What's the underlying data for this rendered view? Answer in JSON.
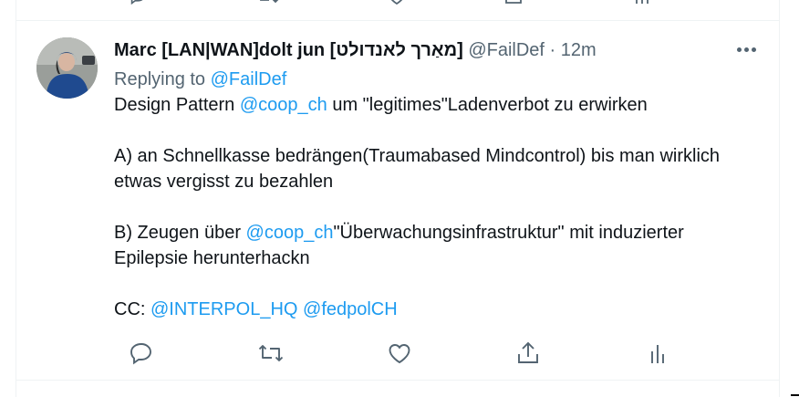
{
  "tweet": {
    "author_name": "Marc [LAN|WAN]dolt jun [מאַרך לאנדולט]",
    "handle": "@FailDef",
    "separator": "·",
    "time": "12m",
    "replying_to_prefix": "Replying to ",
    "replying_to_handle": "@FailDef",
    "body": {
      "p1_pre": "Design Pattern ",
      "p1_mention": "@coop_ch",
      "p1_post": " um \"legitimes\"Ladenverbot zu erwirken",
      "p2": "A) an Schnellkasse bedrängen(Traumabased Mindcontrol) bis man wirklich etwas vergisst zu bezahlen",
      "p3_pre": "B) Zeugen über ",
      "p3_mention": "@coop_ch",
      "p3_post": "\"Überwachungsinfrastruktur\" mit induzierter Epilepsie herunterhackn",
      "p4_pre": "CC: ",
      "p4_mention1": "@INTERPOL_HQ",
      "p4_space": " ",
      "p4_mention2": "@fedpolCH"
    },
    "actions": [
      "reply-icon",
      "retweet-icon",
      "like-icon",
      "share-icon",
      "analytics-icon"
    ]
  },
  "colors": {
    "link": "#1d9bf0",
    "secondary": "#536471",
    "text": "#0f1419",
    "divider": "#eff3f4"
  }
}
